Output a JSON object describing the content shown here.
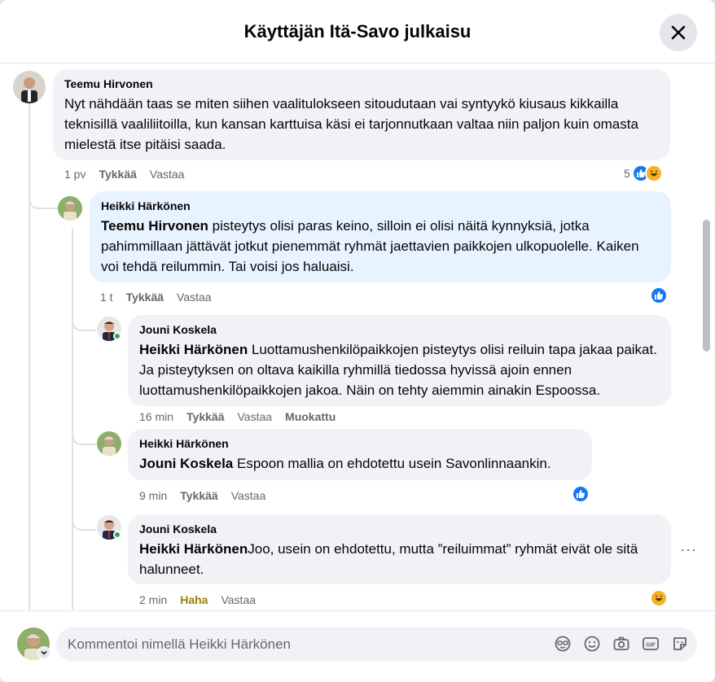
{
  "header": {
    "title": "Käyttäjän Itä-Savo julkaisu"
  },
  "comments": [
    {
      "author": "Teemu Hirvonen",
      "mention": "",
      "text": "Nyt nähdään taas se miten siihen vaalitulokseen sitoudutaan vai syntyykö kiusaus kikkailla teknisillä vaaliliitoilla, kun kansan karttuisa käsi ei tarjonnutkaan valtaa niin paljon kuin omasta mielestä itse pitäisi saada.",
      "time": "1 pv",
      "like": "Tykkää",
      "reply": "Vastaa",
      "reaction_count": "5"
    },
    {
      "author": "Heikki Härkönen",
      "mention": "Teemu Hirvonen",
      "text": " pisteytys olisi paras keino, silloin ei olisi näitä kynnyksiä, jotka pahimmillaan jättävät jotkut pienemmät ryhmät jaettavien paikkojen ulkopuolelle. Kaiken voi tehdä reilummin. Tai voisi jos haluaisi.",
      "time": "1 t",
      "like": "Tykkää",
      "reply": "Vastaa"
    },
    {
      "author": "Jouni Koskela",
      "mention": "Heikki Härkönen",
      "text": " Luottamushenkilöpaikkojen pisteytys olisi reiluin tapa jakaa paikat. Ja pisteytyksen on oltava kaikilla ryhmillä tiedossa hyvissä ajoin ennen luottamushenkilöpaikkojen jakoa. Näin on tehty aiemmin ainakin Espoossa.",
      "time": "16 min",
      "like": "Tykkää",
      "reply": "Vastaa",
      "edited": "Muokattu"
    },
    {
      "author": "Heikki Härkönen",
      "mention": "Jouni Koskela",
      "text": " Espoon mallia on ehdotettu usein Savonlinnaankin.",
      "time": "9 min",
      "like": "Tykkää",
      "reply": "Vastaa"
    },
    {
      "author": "Jouni Koskela",
      "mention": "Heikki Härkönen",
      "text": "Joo, usein on ehdotettu, mutta ”reiluimmat” ryhmät eivät ole sitä halunneet.",
      "time": "2 min",
      "like": "Haha",
      "reply": "Vastaa"
    }
  ],
  "more_options": "···",
  "composer": {
    "placeholder": "Kommentoi nimellä Heikki Härkönen"
  },
  "colors": {
    "like_blue": "#1877f2",
    "haha_yellow": "#f7b125",
    "haha_text": "#9e7d0c",
    "online_green": "#31a24c",
    "highlight_blue": "#e7f3ff"
  }
}
